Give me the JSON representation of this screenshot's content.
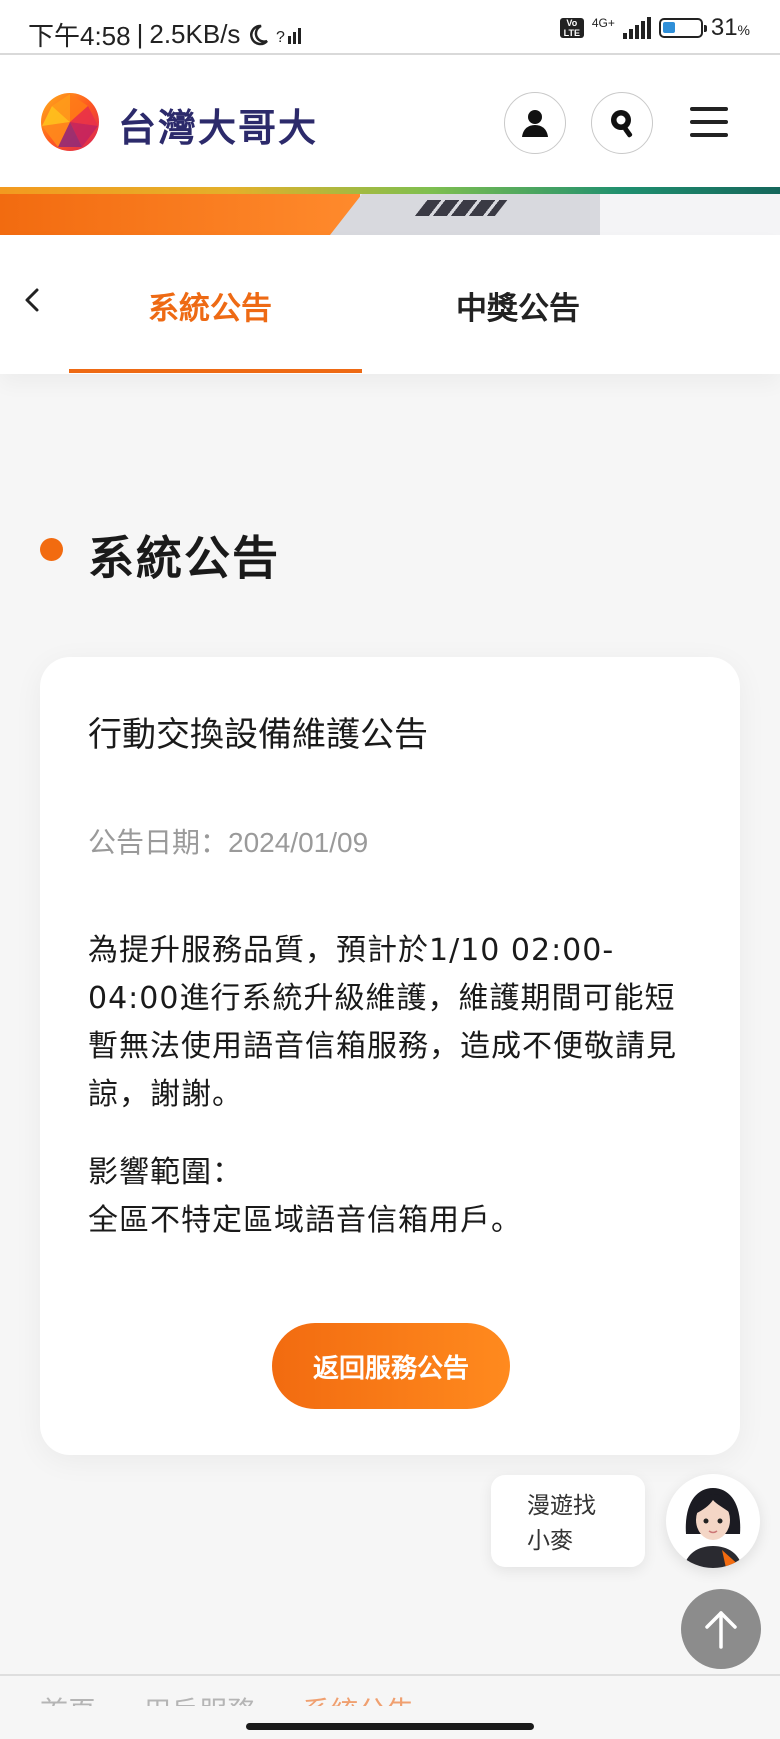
{
  "status_bar": {
    "time": "下午4:58",
    "speed": "2.5KB/s",
    "network": "4G+",
    "volte": "VoLTE",
    "battery": "31",
    "battery_unit": "%"
  },
  "header": {
    "brand": "台灣大哥大",
    "icons": [
      "user-icon",
      "search-icon",
      "menu-icon"
    ]
  },
  "tabs": {
    "items": [
      {
        "label": "系統公告",
        "active": true
      },
      {
        "label": "中獎公告",
        "active": false
      }
    ]
  },
  "section": {
    "title": "系統公告"
  },
  "announcement": {
    "title": "行動交換設備維護公告",
    "date": "公告日期：2024/01/09",
    "body": "為提升服務品質，預計於1/10 02:00-04:00進行系統升級維護，維護期間可能短暫無法使用語音信箱服務，造成不便敬請見諒，謝謝。",
    "scope_label": "影響範圍：",
    "scope": "全區不特定區域語音信箱用戶。",
    "back_button": "返回服務公告"
  },
  "chat": {
    "line1": "漫遊找",
    "line2": "小麥"
  },
  "breadcrumb": {
    "items": [
      "首頁",
      "用戶服務",
      "系統公告"
    ]
  },
  "colors": {
    "accent": "#ee6a14",
    "brand_text": "#2c2a6b"
  }
}
